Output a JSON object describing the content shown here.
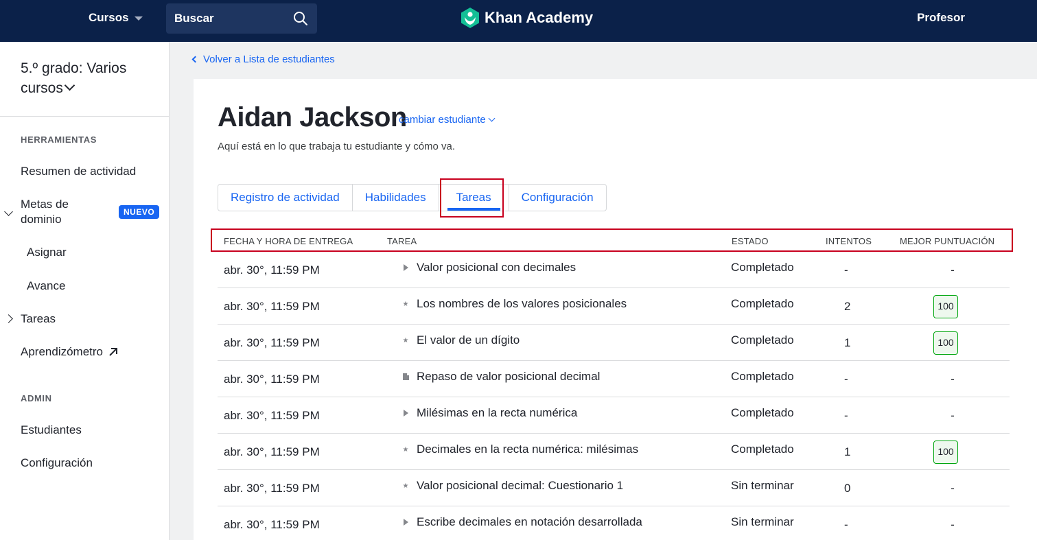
{
  "header": {
    "courses_label": "Cursos",
    "search_placeholder": "Buscar",
    "logo_text": "Khan Academy",
    "user_label": "Profesor"
  },
  "sidebar": {
    "class_title": "5.º grado: Varios cursos",
    "tools_label": "HERRAMIENTAS",
    "items": {
      "activity_summary": "Resumen de actividad",
      "mastery_goals": "Metas de dominio",
      "new_badge": "NUEVO",
      "assign": "Asignar",
      "progress": "Avance",
      "assignments": "Tareas",
      "learnometer": "Aprendizómetro"
    },
    "admin_label": "ADMIN",
    "admin_items": {
      "students": "Estudiantes",
      "settings": "Configuración"
    }
  },
  "main": {
    "back_link": "Volver a Lista de estudiantes",
    "student_name": "Aidan Jackson",
    "switch_student": "cambiar estudiante",
    "subtitle": "Aquí está en lo que trabaja tu estudiante y cómo va.",
    "tabs": [
      "Registro de actividad",
      "Habilidades",
      "Tareas",
      "Configuración"
    ],
    "active_tab": "Tareas",
    "columns": {
      "due": "FECHA Y HORA DE ENTREGA",
      "task": "TAREA",
      "status": "ESTADO",
      "attempts": "INTENTOS",
      "best_score": "MEJOR PUNTUACIÓN"
    },
    "rows": [
      {
        "due": "abr. 30°, 11:59 PM",
        "icon": "video-icon",
        "task": "Valor posicional con decimales",
        "status": "Completado",
        "attempts": "-",
        "score": "-"
      },
      {
        "due": "abr. 30°, 11:59 PM",
        "icon": "exercise-star-icon",
        "task": "Los nombres de los valores posicionales",
        "status": "Completado",
        "attempts": "2",
        "score": "100"
      },
      {
        "due": "abr. 30°, 11:59 PM",
        "icon": "exercise-star-icon",
        "task": "El valor de un dígito",
        "status": "Completado",
        "attempts": "1",
        "score": "100"
      },
      {
        "due": "abr. 30°, 11:59 PM",
        "icon": "article-icon",
        "task": "Repaso de valor posicional decimal",
        "status": "Completado",
        "attempts": "-",
        "score": "-"
      },
      {
        "due": "abr. 30°, 11:59 PM",
        "icon": "video-icon",
        "task": "Milésimas en la recta numérica",
        "status": "Completado",
        "attempts": "-",
        "score": "-"
      },
      {
        "due": "abr. 30°, 11:59 PM",
        "icon": "exercise-star-icon",
        "task": "Decimales en la recta numérica: milésimas",
        "status": "Completado",
        "attempts": "1",
        "score": "100"
      },
      {
        "due": "abr. 30°, 11:59 PM",
        "icon": "exercise-star-icon",
        "task": "Valor posicional decimal: Cuestionario 1",
        "status": "Sin terminar",
        "attempts": "0",
        "score": "-"
      },
      {
        "due": "abr. 30°, 11:59 PM",
        "icon": "video-icon",
        "task": "Escribe decimales en notación desarrollada",
        "status": "Sin terminar",
        "attempts": "-",
        "score": "-"
      }
    ]
  },
  "colors": {
    "nav_bg": "#0b2149",
    "accent": "#1865f2",
    "highlight_box": "#c8001e",
    "score_border": "#00a60e"
  }
}
